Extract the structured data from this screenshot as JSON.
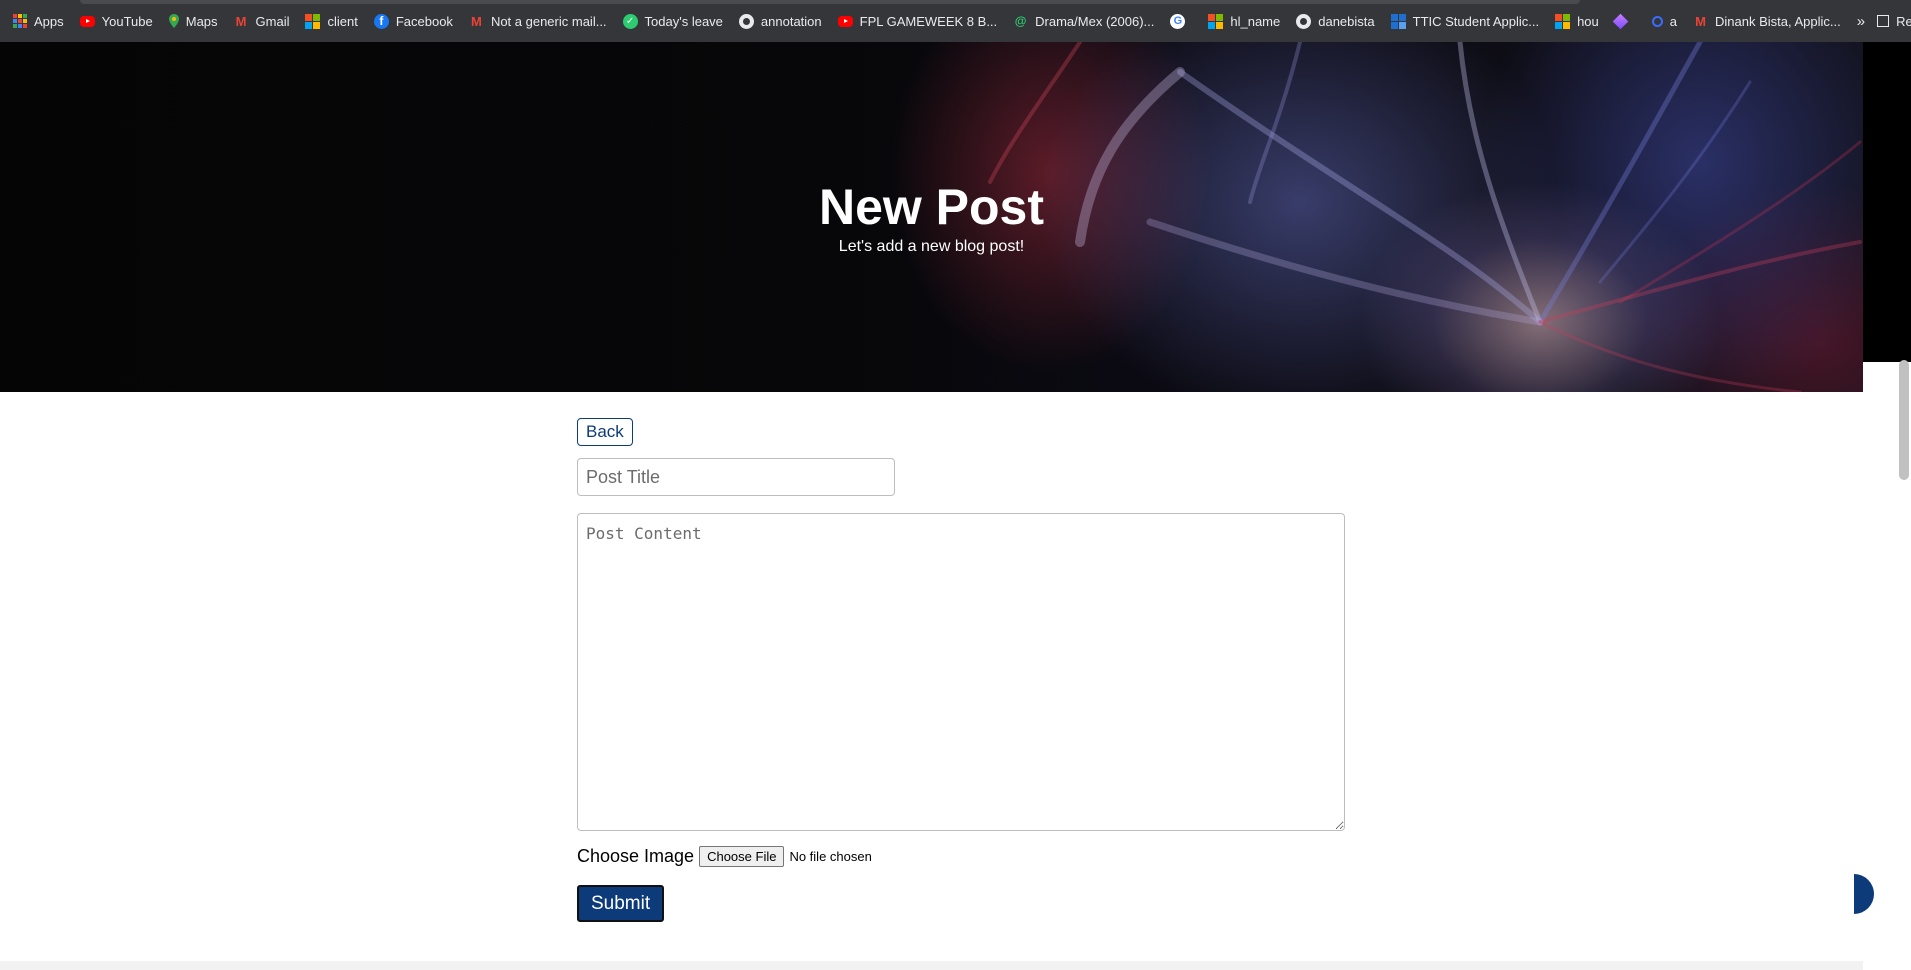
{
  "bookmarks": [
    {
      "label": "Apps",
      "icon": "apps-icon"
    },
    {
      "label": "YouTube",
      "icon": "youtube-icon"
    },
    {
      "label": "Maps",
      "icon": "maps-icon"
    },
    {
      "label": "Gmail",
      "icon": "gmail-icon"
    },
    {
      "label": "client",
      "icon": "microsoft-icon"
    },
    {
      "label": "Facebook",
      "icon": "facebook-icon"
    },
    {
      "label": "Not a generic mail...",
      "icon": "gmail-icon"
    },
    {
      "label": "Today's leave",
      "icon": "leave-icon"
    },
    {
      "label": "annotation",
      "icon": "github-icon"
    },
    {
      "label": "FPL GAMEWEEK 8 B...",
      "icon": "youtube-icon"
    },
    {
      "label": "Drama/Mex (2006)...",
      "icon": "drama-icon"
    },
    {
      "label": "",
      "icon": "google-icon"
    },
    {
      "label": "hl_name",
      "icon": "microsoft-icon"
    },
    {
      "label": "danebista",
      "icon": "github-icon"
    },
    {
      "label": "TTIC Student Applic...",
      "icon": "ttic-icon"
    },
    {
      "label": "hou",
      "icon": "microsoft-icon"
    },
    {
      "label": "",
      "icon": "diamond-icon"
    },
    {
      "label": "a",
      "icon": "ring-icon"
    },
    {
      "label": "Dinank Bista, Applic...",
      "icon": "gmail-icon"
    }
  ],
  "bookmarks_more": "»",
  "reading_list": "Rea",
  "hero": {
    "title": "New Post",
    "subtitle": "Let's add a new blog post!"
  },
  "form": {
    "back_label": "Back",
    "title_placeholder": "Post Title",
    "content_placeholder": "Post Content",
    "image_label": "Choose Image",
    "file_button": "Choose File",
    "file_status": "No file chosen",
    "submit_label": "Submit"
  },
  "colors": {
    "primary": "#0d3b7a",
    "bookmarks_bg": "#35363a"
  }
}
